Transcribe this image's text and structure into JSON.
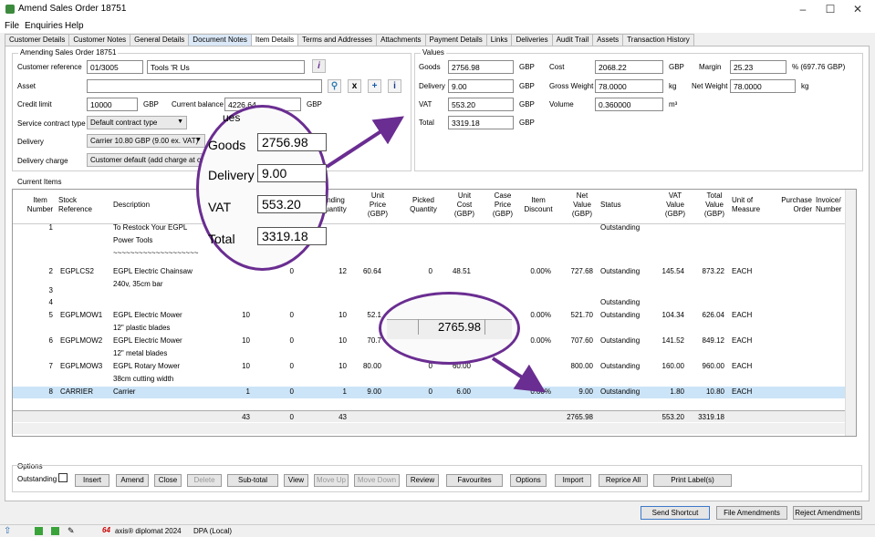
{
  "window": {
    "title": "Amend Sales Order 18751"
  },
  "menu": [
    "File",
    "Enquiries",
    "Help"
  ],
  "tabs": [
    "Customer Details",
    "Customer Notes",
    "General Details",
    "Document Notes",
    "Item Details",
    "Terms and Addresses",
    "Attachments",
    "Payment Details",
    "Links",
    "Deliveries",
    "Audit Trail",
    "Assets",
    "Transaction History"
  ],
  "amending": {
    "legend": "Amending Sales Order 18751",
    "customer_reference_label": "Customer reference",
    "customer_reference": "01/3005",
    "customer_name": "Tools 'R Us",
    "asset_label": "Asset",
    "asset_value": "",
    "credit_limit_label": "Credit limit",
    "credit_limit": "10000",
    "currency": "GBP",
    "current_balance_label": "Current balance",
    "current_balance": "4226.64",
    "service_contract_label": "Service contract type",
    "service_contract": "Default contract type",
    "delivery_label": "Delivery",
    "delivery": "Carrier 10.80 GBP (9.00 ex. VAT)",
    "delivery_charge_label": "Delivery charge",
    "delivery_charge": "Customer default (add charge at orde"
  },
  "values": {
    "legend": "Values",
    "goods_label": "Goods",
    "goods": "2756.98",
    "delivery_label": "Delivery",
    "delivery": "9.00",
    "vat_label": "VAT",
    "vat": "553.20",
    "total_label": "Total",
    "total": "3319.18",
    "currency": "GBP",
    "cost_label": "Cost",
    "cost": "2068.22",
    "gross_weight_label": "Gross Weight",
    "gross_weight": "78.0000",
    "volume_label": "Volume",
    "volume": "0.360000",
    "margin_label": "Margin",
    "margin": "25.23",
    "margin_suffix": "% (697.76 GBP)",
    "net_weight_label": "Net Weight",
    "net_weight": "78.0000",
    "kg": "kg",
    "m3": "m³"
  },
  "items": {
    "legend": "Current Items",
    "headers": {
      "item_number": "Item Number",
      "stock_reference": "Stock Reference",
      "description": "Description",
      "standing_quantity": "nding uantity",
      "unit_price": "Unit Price (GBP)",
      "picked_quantity": "Picked Quantity",
      "unit_cost": "Unit Cost (GBP)",
      "case_price": "Case Price (GBP)",
      "item_discount": "Item Discount",
      "net_value": "Net Value (GBP)",
      "status": "Status",
      "vat_value": "VAT Value (GBP)",
      "total_value": "Total Value (GBP)",
      "unit_of_measure": "Unit of Measure",
      "purchase_order": "Purchase Order",
      "invoice_number": "Invoice/ Number"
    },
    "rows": [
      {
        "n": "1",
        "ref": "",
        "desc": "To Restock Your EGPL",
        "desc2": "Power Tools",
        "desc3": "~~~~~~~~~~~~~~~~~~~~",
        "q1": "",
        "q2": "",
        "q3": "",
        "price": "",
        "picked": "",
        "cost": "",
        "disc": "",
        "net": "",
        "status": "Outstanding",
        "vat": "",
        "total": "",
        "uom": ""
      },
      {
        "n": "2",
        "ref": "EGPLCS2",
        "desc": "EGPL Electric Chainsaw",
        "desc2": "240v, 35cm bar",
        "desc3": "",
        "q1": "",
        "q2": "0",
        "q3": "12",
        "price": "60.64",
        "picked": "0",
        "cost": "48.51",
        "disc": "0.00%",
        "net": "727.68",
        "status": "Outstanding",
        "vat": "145.54",
        "total": "873.22",
        "uom": "EACH"
      },
      {
        "n": "3",
        "ref": "",
        "desc": "",
        "desc2": "",
        "desc3": "",
        "q1": "",
        "q2": "",
        "q3": "",
        "price": "",
        "picked": "",
        "cost": "",
        "disc": "",
        "net": "",
        "status": "",
        "vat": "",
        "total": "",
        "uom": ""
      },
      {
        "n": "4",
        "ref": "",
        "desc": "",
        "desc2": "",
        "desc3": "",
        "q1": "",
        "q2": "",
        "q3": "",
        "price": "",
        "picked": "",
        "cost": "",
        "disc": "",
        "net": "",
        "status": "Outstanding",
        "vat": "",
        "total": "",
        "uom": ""
      },
      {
        "n": "5",
        "ref": "EGPLMOW1",
        "desc": "EGPL Electric Mower",
        "desc2": "12\" plastic blades",
        "desc3": "",
        "q1": "10",
        "q2": "0",
        "q3": "10",
        "price": "52.1",
        "picked": "",
        "cost": "",
        "disc": "0.00%",
        "net": "521.70",
        "status": "Outstanding",
        "vat": "104.34",
        "total": "626.04",
        "uom": "EACH"
      },
      {
        "n": "6",
        "ref": "EGPLMOW2",
        "desc": "EGPL Electric Mower",
        "desc2": "12\" metal blades",
        "desc3": "",
        "q1": "10",
        "q2": "0",
        "q3": "10",
        "price": "70.7",
        "picked": "",
        "cost": "",
        "disc": "0.00%",
        "net": "707.60",
        "status": "Outstanding",
        "vat": "141.52",
        "total": "849.12",
        "uom": "EACH"
      },
      {
        "n": "7",
        "ref": "EGPLMOW3",
        "desc": "EGPL Rotary Mower",
        "desc2": "38cm cutting width",
        "desc3": "",
        "q1": "10",
        "q2": "0",
        "q3": "10",
        "price": "80.00",
        "picked": "0",
        "cost": "60.00",
        "disc": "",
        "net": "800.00",
        "status": "Outstanding",
        "vat": "160.00",
        "total": "960.00",
        "uom": "EACH"
      },
      {
        "n": "8",
        "ref": "CARRIER",
        "desc": "Carrier",
        "desc2": "",
        "desc3": "",
        "q1": "1",
        "q2": "0",
        "q3": "1",
        "price": "9.00",
        "picked": "0",
        "cost": "6.00",
        "disc": "0.00%",
        "net": "9.00",
        "status": "Outstanding",
        "vat": "1.80",
        "total": "10.80",
        "uom": "EACH"
      }
    ],
    "totals": {
      "q1": "43",
      "q2": "0",
      "q3": "43",
      "net": "2765.98",
      "vat": "553.20",
      "total": "3319.18"
    }
  },
  "options": {
    "legend": "Options",
    "outstanding_label": "Outstanding",
    "buttons": [
      "Insert",
      "Amend",
      "Close",
      "Delete",
      "Sub-total",
      "View",
      "Move Up",
      "Move Down",
      "Review",
      "Favourites",
      "Options",
      "Import",
      "Reprice All",
      "Print Label(s)"
    ]
  },
  "footer_buttons": [
    "Send Shortcut",
    "File Amendments",
    "Reject Amendments"
  ],
  "status": {
    "app": "axis® diplomat 2024",
    "db": "DPA (Local)"
  },
  "zoom1": {
    "partial": "ues",
    "goods_label": "Goods",
    "goods": "2756.98",
    "delivery_label": "Delivery",
    "delivery": "9.00",
    "vat_label": "VAT",
    "vat": "553.20",
    "total_label": "Total",
    "total": "3319.18"
  },
  "zoom2": {
    "value": "2765.98"
  },
  "accent_color": "#6a2d91"
}
